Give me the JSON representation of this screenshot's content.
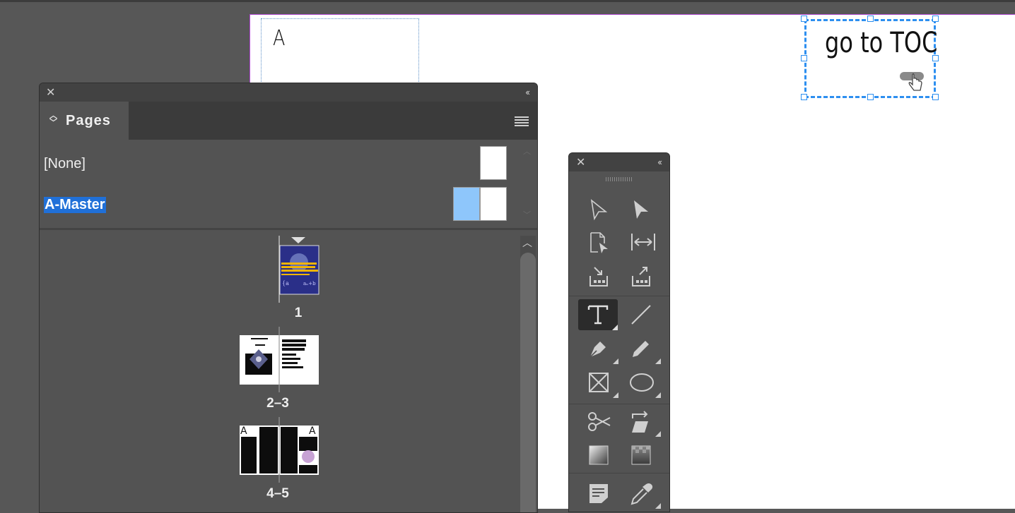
{
  "document": {
    "master_frame_letter": "A",
    "button_text": "go to TOC",
    "selection_color": "#2d8ff0",
    "page_border_color": "#b04bd1"
  },
  "pages_panel": {
    "tab_label": "Pages",
    "masters": [
      {
        "label": "[None]",
        "selected": false
      },
      {
        "label": "A-Master",
        "selected": true
      }
    ],
    "spreads": [
      {
        "label": "1"
      },
      {
        "label": "2–3"
      },
      {
        "label": "4–5"
      }
    ],
    "cover_title_lines": [
      "On Studying",
      "Maths and",
      "Making Friends:",
      "a Coincident Story"
    ]
  },
  "tools_panel": {
    "tools": [
      "selection-tool",
      "direct-selection-tool",
      "page-tool",
      "gap-tool",
      "content-collector-tool",
      "content-placer-tool",
      "type-tool",
      "line-tool",
      "pen-tool",
      "pencil-tool",
      "rectangle-frame-tool",
      "ellipse-tool",
      "scissors-tool",
      "free-transform-tool",
      "gradient-swatch-tool",
      "gradient-feather-tool",
      "note-tool",
      "eyedropper-tool"
    ],
    "active_tool": "type-tool"
  },
  "colors": {
    "pasteboard": "#575757",
    "panel": "#535353",
    "highlight": "#2070d8",
    "master_thumb": "#8ec6fb"
  }
}
